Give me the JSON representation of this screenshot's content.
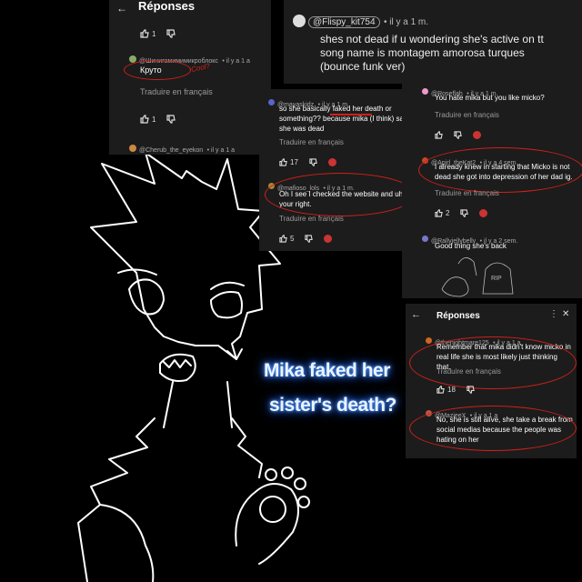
{
  "panel1": {
    "title": "Réponses",
    "comment1": {
      "user": "@Шинигамимимикроблокс",
      "time": "• il y a 1 a",
      "text": "Круто",
      "likes": "1"
    },
    "annotation": "Cool?",
    "translate": "Traduire en français",
    "comment2": {
      "user": "@Cherub_the_eyekon",
      "time": "• il y a 1 a",
      "likes": "1"
    }
  },
  "panel2": {
    "user": "@Flispy_kit754",
    "time": "• il y a 1 m.",
    "text": "shes not dead if u wondering she's active on tt song name is montagem amorosa turques (bounce funk ver)"
  },
  "panel3": {
    "comment1": {
      "user": "@mayaskidz",
      "time": "• il y a 1 m.",
      "text": "so she basically faked her death or something?? because mika (I think) said she was dead",
      "likes": "17"
    },
    "translate": "Traduire en français",
    "comment2": {
      "user": "@mafioso_lols",
      "time": "• il y a 1 m.",
      "text": "Oh I see I checked the website and uhh your right.",
      "likes": "5"
    }
  },
  "panel4": {
    "comment1": {
      "user": "@Roseflah",
      "time": "• il y a 1 m.",
      "text": "You hate mika but you like micko?"
    },
    "translate": "Traduire en français",
    "comment2": {
      "user": "@Apirl_theKat2",
      "time": "• il y a 4 sem.",
      "text": "I already knew in starting that Micko is not dead she got into depression of her dad ig.",
      "likes": "2"
    },
    "comment3": {
      "user": "@Rallyjellybelly",
      "time": "• il y a 2 sem.",
      "text": "Good thing she's back"
    },
    "sketch_text": "RIP"
  },
  "panel5": {
    "title": "Réponses",
    "comment1": {
      "user": "@thenightmare125",
      "time": "• il y a 1 a",
      "text": "Remember that mika didn't know micko in real life she is most likely just thinking that.",
      "likes": "18"
    },
    "translate": "Traduire en français",
    "comment2": {
      "user": "@MazieeX",
      "time": "• il y a 1 a",
      "text": "No, she is still alive, she take a break from social medias because the people was hating on her"
    }
  },
  "title": {
    "line1": "Mika faked her",
    "line2": "sister's death?"
  },
  "colors": {
    "panel_bg": "#1c1c1c",
    "annotation": "#d0201a",
    "glow": "#3a7bff"
  }
}
